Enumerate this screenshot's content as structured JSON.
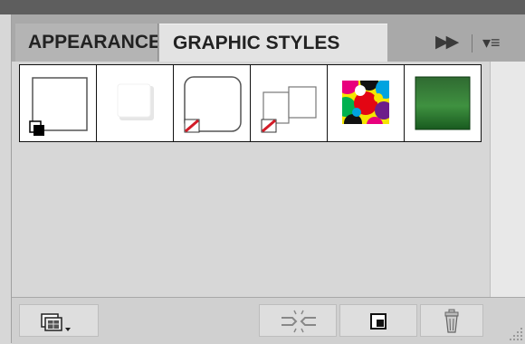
{
  "tabs": [
    {
      "label": "APPEARANCE",
      "active": false
    },
    {
      "label": "GRAPHIC STYLES",
      "active": true
    }
  ],
  "tabbar": {
    "collapse_icon": "double-arrow-right-icon",
    "menu_icon": "panel-menu-icon"
  },
  "swatches": [
    {
      "name": "Default Graphic Style",
      "icon": "default-style-swatch"
    },
    {
      "name": "Soft Drop Shadow",
      "icon": "drop-shadow-swatch"
    },
    {
      "name": "Rounded Corners (None)",
      "icon": "rounded-none-swatch"
    },
    {
      "name": "Two Boxes (None)",
      "icon": "two-boxes-none-swatch"
    },
    {
      "name": "Multicolor Pattern",
      "icon": "pattern-swatch"
    },
    {
      "name": "Green Gradient",
      "icon": "green-gradient-swatch"
    }
  ],
  "bottom_buttons": [
    {
      "icon": "graphic-styles-library-menu-icon"
    },
    {
      "icon": "break-link-icon"
    },
    {
      "icon": "new-graphic-style-icon"
    },
    {
      "icon": "trash-icon"
    }
  ]
}
